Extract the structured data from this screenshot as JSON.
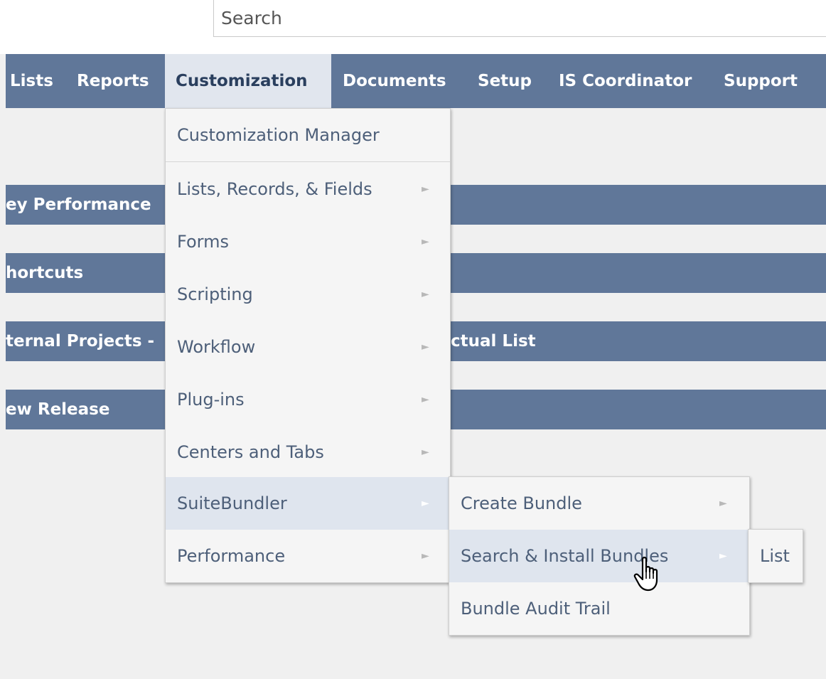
{
  "search": {
    "placeholder": "Search"
  },
  "nav": {
    "items": [
      "Lists",
      "Reports",
      "Customization",
      "Documents",
      "Setup",
      "IS Coordinator",
      "Support"
    ]
  },
  "portlets": [
    "ey Performance",
    "hortcuts",
    "ternal Projects -",
    "ctual List",
    "ew Release"
  ],
  "customization_menu": {
    "items": [
      "Customization Manager",
      "Lists, Records, & Fields",
      "Forms",
      "Scripting",
      "Workflow",
      "Plug-ins",
      "Centers and Tabs",
      "SuiteBundler",
      "Performance"
    ],
    "arrow": "►"
  },
  "suitebundler_menu": {
    "items": [
      "Create Bundle",
      "Search & Install Bundles",
      "Bundle Audit Trail"
    ]
  },
  "search_install_menu": {
    "items": [
      "List"
    ]
  },
  "colors": {
    "nav_background": "#607799",
    "active_tab": "#e1e6ee",
    "menu_background": "#f5f5f5",
    "menu_highlight": "#dfe5ee",
    "text": "#4d5f79"
  },
  "icons": [
    "chevron-right-icon",
    "hand-pointer-cursor-icon"
  ]
}
